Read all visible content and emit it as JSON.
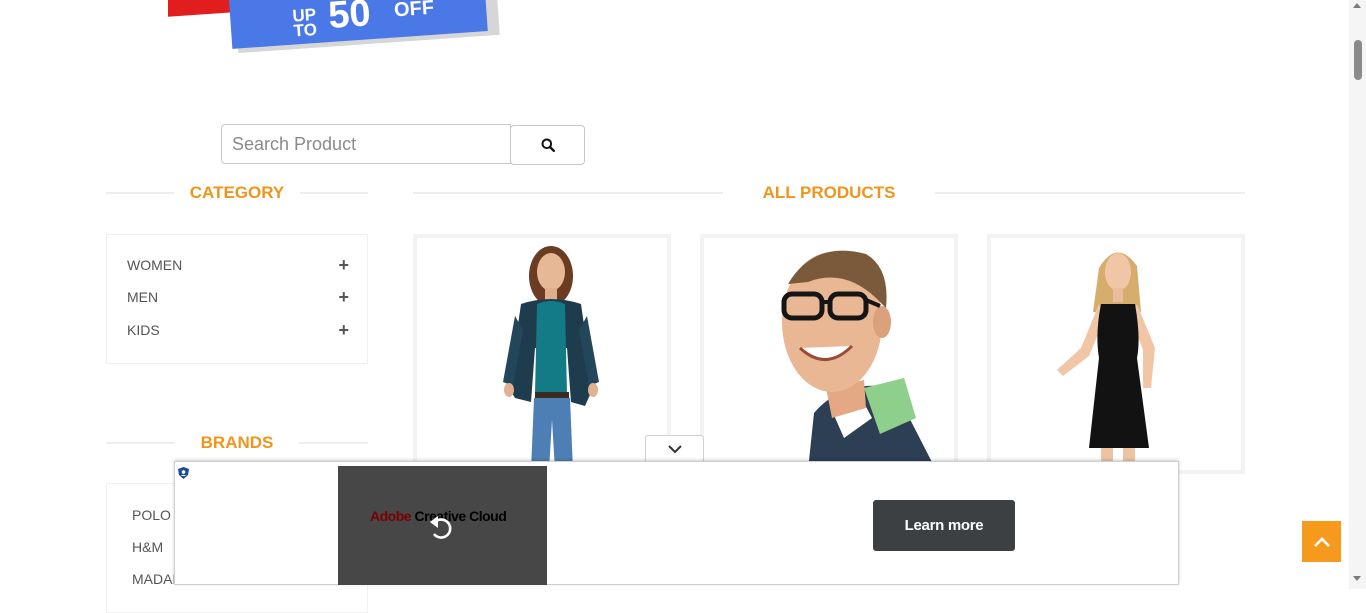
{
  "promo": {
    "up": "UP",
    "to": "TO",
    "number": "50",
    "percent": "%",
    "off": "OFF"
  },
  "search": {
    "placeholder": "Search Product",
    "value": ""
  },
  "category": {
    "title": "CATEGORY",
    "items": [
      {
        "label": "WOMEN"
      },
      {
        "label": "MEN"
      },
      {
        "label": "KIDS"
      }
    ],
    "expand_symbol": "+"
  },
  "brands": {
    "title": "BRANDS",
    "items": [
      {
        "label": "POLO"
      },
      {
        "label": "H&M"
      },
      {
        "label": "MADAME"
      }
    ]
  },
  "products": {
    "title": "ALL PRODUCTS",
    "items": [
      {
        "image": "woman-cardigan-jeans"
      },
      {
        "image": "man-glasses-polo"
      },
      {
        "image": "woman-black-dress"
      }
    ]
  },
  "ad": {
    "brand_part1": "Adobe",
    "brand_part2": "Creative Cloud",
    "cta": "Learn more"
  },
  "icons": {
    "search": "search-icon",
    "collapse": "chevron-down-icon",
    "replay": "replay-icon",
    "scroll_top": "chevron-up-icon",
    "ad_info": "shield-icon"
  },
  "colors": {
    "accent": "#f0951b",
    "scroll_top_bg": "#f59a1c",
    "promo_blue": "#4a78e6",
    "promo_red": "#e11d1d",
    "cta_bg": "#3c4043"
  }
}
